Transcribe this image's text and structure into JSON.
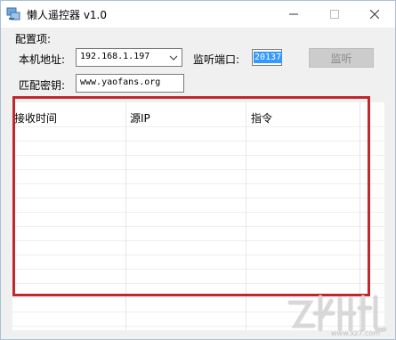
{
  "window": {
    "title": "懒人遥控器 v1.0",
    "icon": "computer-remote-icon"
  },
  "config": {
    "group_label": "配置项:",
    "local_address_label": "本机地址:",
    "local_address_value": "192.168.1.197",
    "listen_port_label": "监听端口:",
    "listen_port_value": "20137",
    "listen_button": "监听",
    "key_label": "匹配密钥:",
    "key_value": "www.yaofans.org"
  },
  "table": {
    "columns": [
      "接收时间",
      "源IP",
      "指令"
    ],
    "rows": []
  },
  "watermark": {
    "text": "www.xz7.com"
  },
  "colors": {
    "highlight_box": "#c0282d",
    "selection": "#3399ff"
  }
}
